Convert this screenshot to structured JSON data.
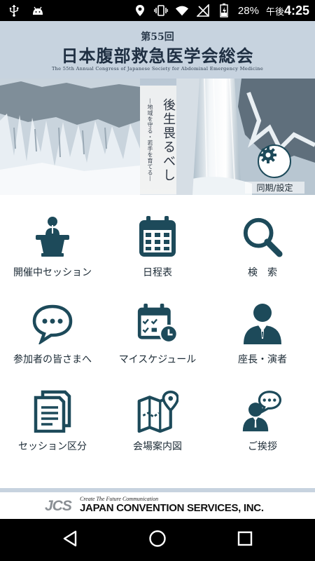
{
  "status_bar": {
    "battery_percent": "28%",
    "ampm": "午後",
    "time": "4:25",
    "icons": [
      "usb-icon",
      "android-icon",
      "location-icon",
      "vibrate-icon",
      "wifi-icon",
      "no-signal-icon",
      "battery-icon"
    ]
  },
  "header": {
    "edition": "第55回",
    "title": "日本腹部救急医学会総会",
    "subtitle": "The 55th Annual Congress of Japanese Society for Abdominal Emergency Medicine"
  },
  "hero": {
    "motto": "後生畏るべし",
    "motto_sub": "—地域を守る・若手を育てる—",
    "sync_label": "同期/設定"
  },
  "menu": [
    {
      "label": "開催中セッション",
      "icon": "podium-icon"
    },
    {
      "label": "日程表",
      "icon": "calendar-icon"
    },
    {
      "label": "検　索",
      "icon": "search-icon"
    },
    {
      "label": "参加者の皆さまへ",
      "icon": "chat-bubble-icon"
    },
    {
      "label": "マイスケジュール",
      "icon": "calendar-clock-icon"
    },
    {
      "label": "座長・演者",
      "icon": "person-icon"
    },
    {
      "label": "セッション区分",
      "icon": "documents-icon"
    },
    {
      "label": "会場案内図",
      "icon": "map-pin-icon"
    },
    {
      "label": "ご挨拶",
      "icon": "greeting-icon"
    }
  ],
  "footer": {
    "logo": "JCS",
    "tagline": "Create The Future Communication",
    "company": "JAPAN CONVENTION SERVICES, INC."
  },
  "colors": {
    "icon": "#1d4a5a",
    "header_bg": "#c7d3df"
  }
}
